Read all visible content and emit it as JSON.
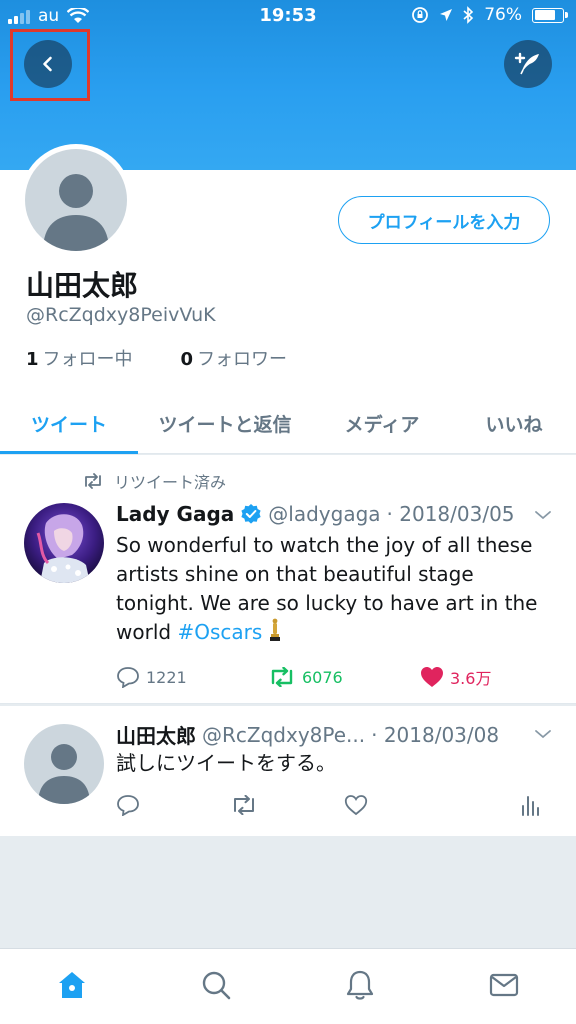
{
  "status_bar": {
    "carrier": "au",
    "time": "19:53",
    "battery_percent": "76%",
    "battery_level": 0.76
  },
  "header": {
    "back_icon": "chevron-left-icon",
    "compose_icon": "compose-quill-icon"
  },
  "profile": {
    "edit_button_label": "プロフィールを入力",
    "display_name": "山田太郎",
    "handle": "@RcZqdxy8PeivVuK",
    "following_count": "1",
    "following_label": "フォロー中",
    "followers_count": "0",
    "followers_label": "フォロワー"
  },
  "tabs": [
    {
      "label": "ツイート",
      "active": true
    },
    {
      "label": "ツイートと返信",
      "active": false
    },
    {
      "label": "メディア",
      "active": false
    },
    {
      "label": "いいね",
      "active": false
    }
  ],
  "tweets": [
    {
      "retweet_label": "リツイート済み",
      "name": "Lady Gaga",
      "handle": "@ladygaga",
      "date": "·  2018/03/05",
      "text": "So wonderful to watch the joy of all these artists shine on that beautiful stage tonight. We are so lucky to have art in the world",
      "hashtag": "#Oscars",
      "replies": "1221",
      "retweets": "6076",
      "likes": "3.6万"
    },
    {
      "name": "山田太郎",
      "handle": "@RcZqdxy8Pe...",
      "date": "·  2018/03/08",
      "text": "試しにツイートをする。"
    }
  ],
  "colors": {
    "accent": "#1da1f2",
    "retweet_green": "#17bf63",
    "like_red": "#e0245e",
    "header_blue": "#2a9ff0"
  }
}
